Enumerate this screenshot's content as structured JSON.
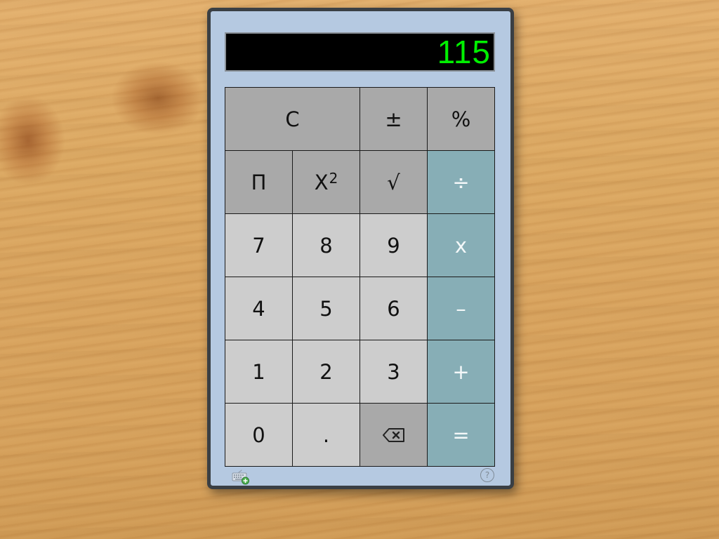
{
  "display": {
    "value": "115"
  },
  "keys": {
    "clear": "C",
    "plus_minus": "±",
    "percent": "%",
    "pi": "Π",
    "square_base": "X",
    "square_exp": "2",
    "sqrt": "√",
    "divide": "÷",
    "seven": "7",
    "eight": "8",
    "nine": "9",
    "multiply": "x",
    "four": "4",
    "five": "5",
    "six": "6",
    "minus": "–",
    "one": "1",
    "two": "2",
    "three": "3",
    "plus": "+",
    "zero": "0",
    "decimal": ".",
    "backspace_icon": "backspace-icon",
    "equals": "="
  },
  "footer": {
    "keyboard_icon": "keyboard-add-icon",
    "help_label": "?"
  },
  "colors": {
    "panel": "#b5c9e1",
    "display_text": "#00f000",
    "function_key": "#a9a9a9",
    "digit_key": "#cdcdcd",
    "operator_key": "#87aeb6"
  }
}
